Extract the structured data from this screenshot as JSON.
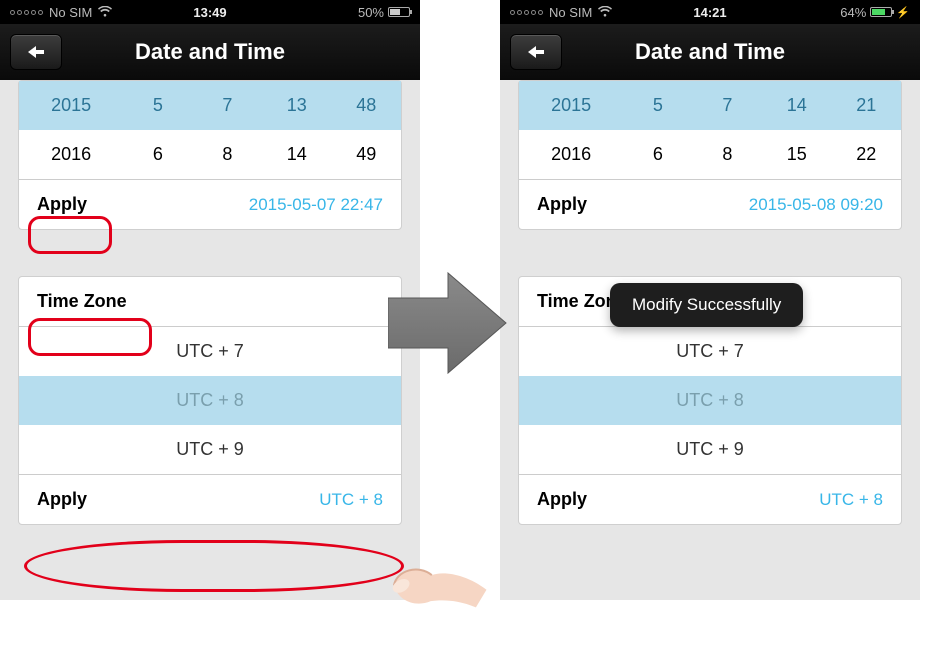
{
  "left": {
    "status": {
      "carrier": "No SIM",
      "time": "13:49",
      "battery_pct": "50%",
      "battery_fill_pct": 50,
      "charging": false
    },
    "nav_title": "Date and Time",
    "picker": {
      "selected": {
        "c0": "2015",
        "c1": "5",
        "c2": "7",
        "c3": "13",
        "c4": "48"
      },
      "next": {
        "c0": "2016",
        "c1": "6",
        "c2": "8",
        "c3": "14",
        "c4": "49"
      }
    },
    "apply_label": "Apply",
    "apply_value": "2015-05-07 22:47",
    "tz_header": "Time Zone",
    "tz_opts": {
      "a": "UTC + 7",
      "b": "UTC + 8",
      "c": "UTC + 9"
    },
    "tz_apply_label": "Apply",
    "tz_apply_value": "UTC + 8"
  },
  "right": {
    "status": {
      "carrier": "No SIM",
      "time": "14:21",
      "battery_pct": "64%",
      "battery_fill_pct": 64,
      "charging": true
    },
    "nav_title": "Date and Time",
    "picker": {
      "selected": {
        "c0": "2015",
        "c1": "5",
        "c2": "7",
        "c3": "14",
        "c4": "21"
      },
      "next": {
        "c0": "2016",
        "c1": "6",
        "c2": "8",
        "c3": "15",
        "c4": "22"
      }
    },
    "apply_label": "Apply",
    "apply_value": "2015-05-08 09:20",
    "tz_header": "Time Zone",
    "tz_opts": {
      "a": "UTC + 7",
      "b": "UTC + 8",
      "c": "UTC + 9"
    },
    "tz_apply_label": "Apply",
    "tz_apply_value": "UTC + 8",
    "toast": "Modify Successfully"
  }
}
